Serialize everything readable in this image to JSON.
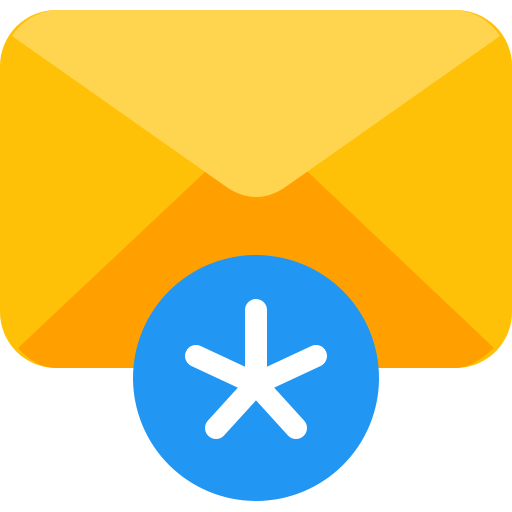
{
  "icon": {
    "name": "mail-asterisk-icon",
    "parts": [
      "envelope-icon",
      "asterisk-badge-icon"
    ]
  },
  "colors": {
    "envelope_body": "#FFC107",
    "envelope_flap": "#FFD54F",
    "envelope_bottom": "#FFA000",
    "badge": "#2196F3",
    "asterisk": "#FFFFFF"
  }
}
